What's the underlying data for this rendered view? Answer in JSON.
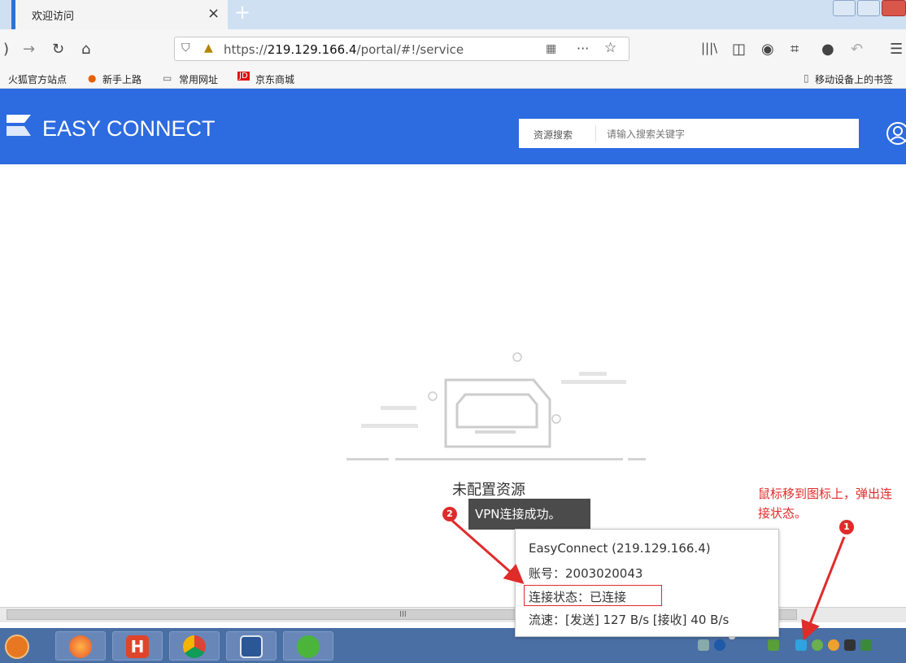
{
  "browser": {
    "tab_title": "欢迎访问",
    "tab_close": "×",
    "new_tab": "+",
    "url_prefix": "https://",
    "url_host": "219.129.166.4",
    "url_path": "/portal/#!/service",
    "more": "···",
    "bookmarks": [
      "火狐官方站点",
      "新手上路",
      "常用网址",
      "京东商城"
    ],
    "mobile_bookmarks": "移动设备上的书签"
  },
  "header": {
    "logo": "EASY CONNECT",
    "search_label": "资源搜索",
    "search_placeholder": "请输入搜索关键字",
    "brand_color": "#2d6be0"
  },
  "main": {
    "empty_text": "未配置资源"
  },
  "toast": {
    "badge": "2",
    "text": "VPN连接成功。"
  },
  "annotation": {
    "badge": "1",
    "text": "鼠标移到图标上，弹出连接状态。",
    "color": "#e02b2b"
  },
  "status_popup": {
    "title": "EasyConnect (219.129.166.4)",
    "account": "账号：2003020043",
    "status": "连接状态：已连接",
    "speed": "流速：[发送] 127 B/s [接收] 40 B/s"
  },
  "scrollbar": {
    "grip": "III"
  },
  "taskbar": {
    "apps": [
      "start-icon",
      "firefox-icon",
      "hbuilder-icon",
      "chrome-icon",
      "word-icon",
      "wechat-icon"
    ]
  }
}
